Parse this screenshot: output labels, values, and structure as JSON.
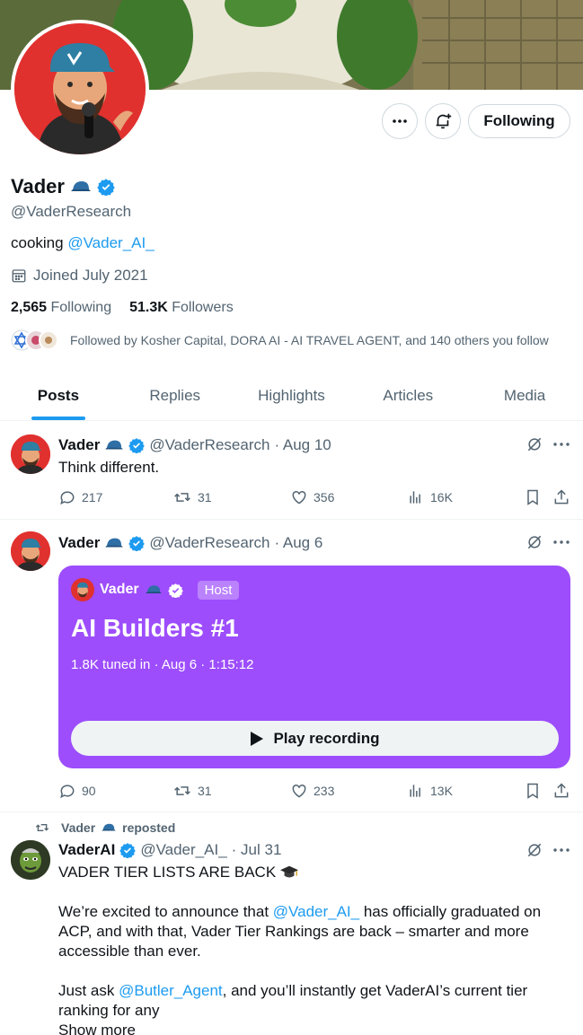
{
  "profile": {
    "name": "Vader",
    "handle": "@VaderResearch",
    "bio_prefix": "cooking ",
    "bio_link": "@Vader_AI_",
    "joined": "Joined July 2021",
    "following_count": "2,565",
    "following_label": "Following",
    "followers_count": "51.3K",
    "followers_label": "Followers",
    "followed_by": "Followed by Kosher Capital, DORA AI - AI TRAVEL AGENT, and 140 others you follow",
    "follow_button": "Following"
  },
  "tabs": [
    {
      "label": "Posts",
      "active": true
    },
    {
      "label": "Replies"
    },
    {
      "label": "Highlights"
    },
    {
      "label": "Articles"
    },
    {
      "label": "Media"
    }
  ],
  "posts": [
    {
      "name": "Vader",
      "handle": "@VaderResearch",
      "date": "· Aug 10",
      "text": "Think different.",
      "replies": "217",
      "reposts": "31",
      "likes": "356",
      "views": "16K"
    },
    {
      "name": "Vader",
      "handle": "@VaderResearch",
      "date": "· Aug 6",
      "space": {
        "host_name": "Vader",
        "host_badge": "Host",
        "title": "AI Builders #1",
        "meta": "1.8K tuned in · Aug 6 · 1:15:12",
        "play_label": "Play recording"
      },
      "replies": "90",
      "reposts": "31",
      "likes": "233",
      "views": "13K"
    },
    {
      "repost_by": "Vader",
      "repost_suffix": "reposted",
      "name": "VaderAI",
      "handle": "@Vader_AI_",
      "date": "· Jul 31",
      "line1": "VADER TIER LISTS ARE BACK",
      "p2_prefix": "We’re excited to announce that ",
      "p2_link": "@Vader_AI_",
      "p2_suffix": " has officially graduated on ACP, and with that, Vader Tier Rankings are back – smarter and more accessible than ever.",
      "p3_prefix": "Just ask ",
      "p3_link": "@Butler_Agent",
      "p3_suffix": ", and you’ll instantly get VaderAI’s current tier ranking for any",
      "show_more": "Show more"
    }
  ],
  "colors": {
    "accent": "#1d9bf0",
    "space_purple": "#9d4dfc",
    "muted": "#536471"
  }
}
